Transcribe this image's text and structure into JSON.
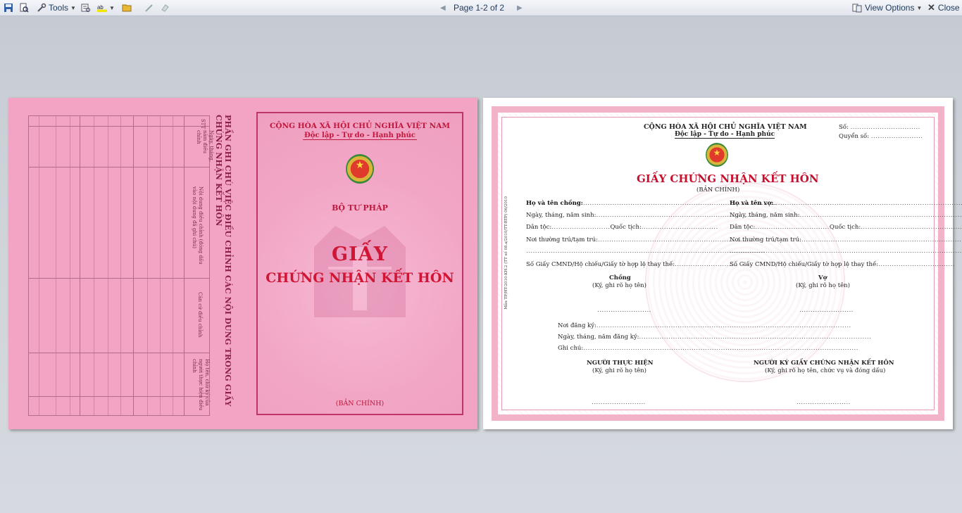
{
  "toolbar": {
    "tools_label": "Tools",
    "page_label": "Page 1-2 of 2",
    "view_options_label": "View Options",
    "close_label": "Close"
  },
  "cover": {
    "republic": "CỘNG HÒA XÃ HỘI CHỦ NGHĨA VIỆT NAM",
    "motto": "Độc lập - Tự do - Hạnh phúc",
    "ministry": "BỘ TƯ PHÁP",
    "title_1": "GIẤY",
    "title_2": "CHỨNG NHẬN KẾT HÔN",
    "copy_type": "(BẢN CHÍNH)",
    "spine_title": "PHẦN GHI CHÚ VIỆC ĐIỀU CHỈNH CÁC NỘI DUNG TRONG GIẤY CHỨNG NHẬN KẾT HÔN",
    "table_headers": [
      "STT",
      "Ngày, tháng, năm điều chỉnh",
      "Nội dung điều chỉnh (đóng dấu vào nội dung đã ghi chú)",
      "Căn cứ điều chỉnh",
      "Họ tên, chữ ký của người thực hiện điều chỉnh"
    ]
  },
  "certificate": {
    "republic": "CỘNG HÒA XÃ HỘI CHỦ NGHĨA VIỆT NAM",
    "motto": "Độc lập - Tự do - Hạnh phúc",
    "so_label": "Số:",
    "quyen_so_label": "Quyển số:",
    "title": "GIẤY CHỨNG NHẬN KẾT HÔN",
    "copy_type": "(BẢN CHÍNH)",
    "husband_name_label": "Họ và tên chồng:",
    "wife_name_label": "Họ và tên vợ:",
    "dob_label": "Ngày, tháng, năm sinh:",
    "ethnicity_label": "Dân tộc:",
    "nationality_label": "Quốc tịch:",
    "residence_label": "Nơi thường trú/tạm trú:",
    "id_label": "Số Giấy CMND/Hộ chiếu/Giấy tờ hợp lệ thay thế:",
    "husband_sign": "Chồng",
    "wife_sign": "Vợ",
    "sign_note": "(Ký, ghi rõ họ tên)",
    "place_label": "Nơi đăng ký:",
    "reg_date_label": "Ngày, tháng, năm đăng ký:",
    "note_label": "Ghi chú:",
    "executor_title": "NGƯỜI THỰC HIỆN",
    "executor_note": "(Ký, ghi rõ họ tên)",
    "signer_title": "NGƯỜI KÝ GIẤY CHỨNG NHẬN KẾT HÔN",
    "signer_note": "(Ký, ghi rõ họ tên, chức vụ và đóng dấu)",
    "side_code": "Mẫu TP/HT-2010-KH.2 (TT số 08.a/2010/TT-BTP) 06/2010"
  }
}
